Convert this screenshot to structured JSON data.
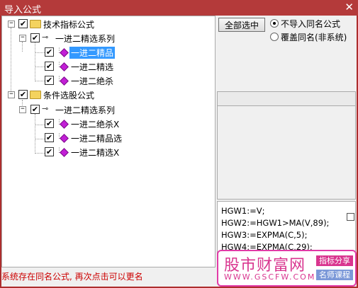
{
  "window": {
    "title": "导入公式",
    "close_glyph": "✕"
  },
  "tree": {
    "groups": [
      {
        "label": "技术指标公式",
        "series": {
          "label": "一进二精选系列",
          "items": [
            "一进二精品",
            "一进二精选",
            "一进二绝杀"
          ]
        }
      },
      {
        "label": "条件选股公式",
        "series": {
          "label": "一进二精选系列",
          "items": [
            "一进二绝杀X",
            "一进二精品选",
            "一进二精选X"
          ]
        }
      }
    ],
    "selected_item": "一进二精品"
  },
  "actions": {
    "select_all_label": "全部选中"
  },
  "options": [
    {
      "label": "不导入同名公式",
      "selected": true
    },
    {
      "label": "覆盖同名(非系统)",
      "selected": false
    }
  ],
  "code_lines": [
    "HGW1:=V;",
    "HGW2:=HGW1>MA(V,89);",
    "HGW3:=EXPMA(C,5);",
    "HGW4:=EXPMA(C,29);"
  ],
  "status_text": "系统存在同名公式, 再次点击可以更名",
  "watermark": {
    "title": "股市财富网",
    "url": "WWW.GSCFW.COM",
    "tag1": "指标分享",
    "tag2": "名师课程"
  },
  "colors": {
    "titlebar": "#b43a3a",
    "selection": "#3399ff",
    "status": "#cc0000",
    "watermark": "#d9358f"
  }
}
